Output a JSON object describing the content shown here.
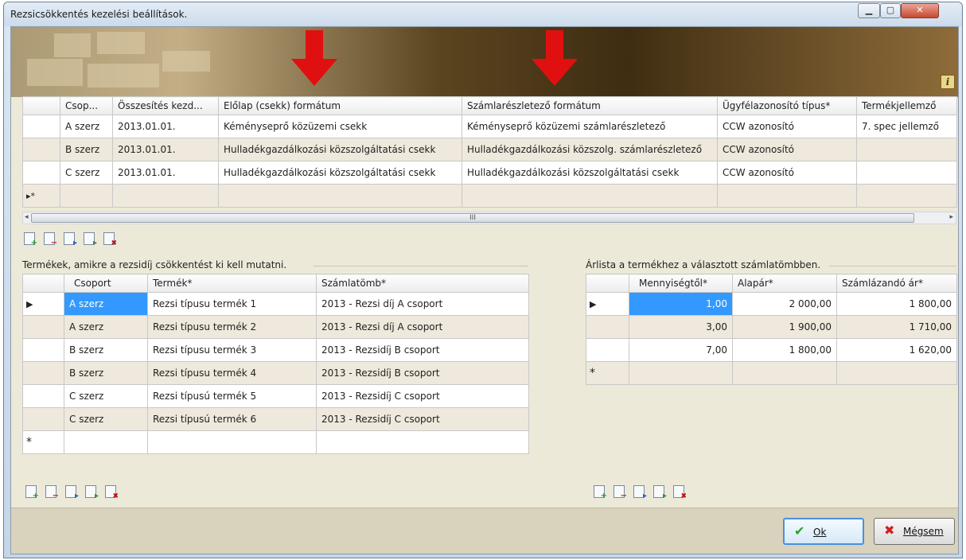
{
  "window": {
    "title": "Rezsicsökkentés kezelési beállítások.",
    "minimize_glyph": "▁",
    "maximize_glyph": "▢",
    "close_glyph": "✕"
  },
  "banner": {
    "info_icon_label": "i"
  },
  "top_grid": {
    "columns": [
      "Csop...",
      "Összesítés kezd...",
      "Előlap (csekk) formátum",
      "Számlarészletező formátum",
      "Ügyfélazonosító típus*",
      "Termékjellemző"
    ],
    "rows": [
      {
        "csoport": "A szerz",
        "kezdet": "2013.01.01.",
        "elolap": "Kéményseprő közüzemi csekk",
        "szamlareszletezo": "Kéményseprő közüzemi számlarészletező",
        "ugyfelazonosito": "CCW azonosító",
        "termekjellemzo": "7. spec jellemző"
      },
      {
        "csoport": "B szerz",
        "kezdet": "2013.01.01.",
        "elolap": "Hulladékgazdálkozási közszolgáltatási csekk",
        "szamlareszletezo": "Hulladékgazdálkozási közszolg. számlarészletező",
        "ugyfelazonosito": "CCW azonosító",
        "termekjellemzo": ""
      },
      {
        "csoport": "C szerz",
        "kezdet": "2013.01.01.",
        "elolap": "Hulladékgazdálkozási közszolgáltatási csekk",
        "szamlareszletezo": "Hulladékgazdálkozási közszolgáltatási csekk",
        "ugyfelazonosito": "CCW azonosító",
        "termekjellemzo": ""
      }
    ],
    "new_row_marker": "▸*",
    "scroll_grip": "III",
    "scroll_left": "◂",
    "scroll_right": "▸"
  },
  "products_panel": {
    "label": "Termékek, amikre a rezsidíj csökkentést ki kell mutatni.",
    "columns": [
      "Csoport",
      "Termék*",
      "Számlatömb*"
    ],
    "rows": [
      {
        "marker": "▶",
        "csoport": "A szerz",
        "termek": "Rezsi típusu termék 1",
        "szamlatomb": "2013 - Rezsi díj A csoport"
      },
      {
        "marker": "",
        "csoport": "A szerz",
        "termek": "Rezsi típusu termék 2",
        "szamlatomb": "2013 - Rezsi díj A csoport"
      },
      {
        "marker": "",
        "csoport": "B szerz",
        "termek": "Rezsi típusu termék 3",
        "szamlatomb": "2013 - Rezsidíj B csoport"
      },
      {
        "marker": "",
        "csoport": "B szerz",
        "termek": "Rezsi típusu termék 4",
        "szamlatomb": "2013 - Rezsidíj B csoport"
      },
      {
        "marker": "",
        "csoport": "C szerz",
        "termek": "Rezsi típusú termék 5",
        "szamlatomb": "2013 - Rezsidíj C csoport"
      },
      {
        "marker": "",
        "csoport": "C szerz",
        "termek": "Rezsi típusú termék 6",
        "szamlatomb": "2013 - Rezsidíj C csoport"
      }
    ],
    "new_row_marker": "*"
  },
  "price_panel": {
    "label": "Árlista a termékhez a választott számlatömbben.",
    "columns": [
      "Mennyiségtől*",
      "Alapár*",
      "Számlázandó ár*"
    ],
    "rows": [
      {
        "marker": "▶",
        "mennyiseg": "1,00",
        "alapar": "2 000,00",
        "szamlazando": "1 800,00"
      },
      {
        "marker": "",
        "mennyiseg": "3,00",
        "alapar": "1 900,00",
        "szamlazando": "1 710,00"
      },
      {
        "marker": "",
        "mennyiseg": "7,00",
        "alapar": "1 800,00",
        "szamlazando": "1 620,00"
      }
    ],
    "new_row_marker": "*"
  },
  "toolbar_icons": [
    "add-row-icon",
    "delete-row-icon",
    "import-icon",
    "export-icon",
    "clear-icon"
  ],
  "buttons": {
    "ok_label": "Ok",
    "ok_icon": "✔",
    "cancel_label": "Mégsem",
    "cancel_icon": "✖"
  },
  "colors": {
    "selection": "#3399ff",
    "alt_row": "#efe8dc",
    "arrow": "#e01010",
    "panel_bg": "#ece9d8"
  }
}
